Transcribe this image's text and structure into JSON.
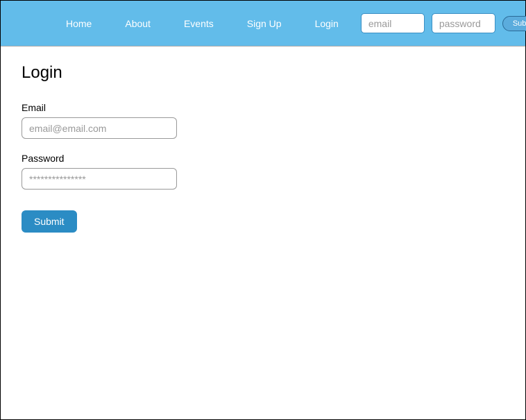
{
  "nav": {
    "links": [
      "Home",
      "About",
      "Events",
      "Sign Up",
      "Login"
    ],
    "email_placeholder": "email",
    "password_placeholder": "password",
    "submit_label": "Submit"
  },
  "page": {
    "title": "Login"
  },
  "form": {
    "email_label": "Email",
    "email_placeholder": "email@email.com",
    "password_label": "Password",
    "password_placeholder": "***************",
    "submit_label": "Submit"
  }
}
